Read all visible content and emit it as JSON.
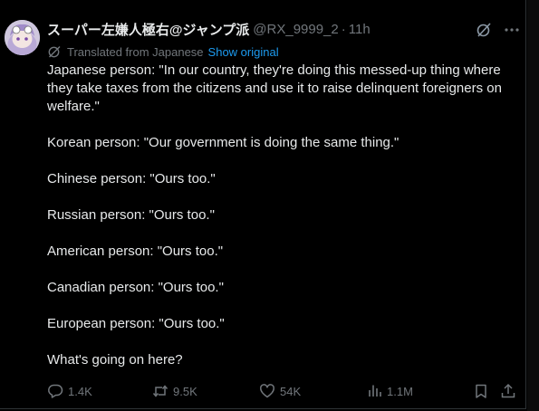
{
  "tweet": {
    "display_name": "スーパー左嫌人極右@ジャンプ派",
    "handle": "@RX_9999_2",
    "separator": "·",
    "time": "11h",
    "translated_label": "Translated from Japanese",
    "show_original_label": "Show original",
    "paragraphs": [
      "Japanese person: \"In our country, they're doing this messed-up thing where they take taxes from the citizens and use it to raise delinquent foreigners on welfare.\"",
      "Korean person: \"Our government is doing the same thing.\"",
      "Chinese person: \"Ours too.\"",
      "Russian person: \"Ours too.\"",
      "American person: \"Ours too.\"",
      "Canadian person: \"Ours too.\"",
      "European person: \"Ours too.\"",
      "What's going on here?"
    ]
  },
  "actions": {
    "replies": "1.4K",
    "reposts": "9.5K",
    "likes": "54K",
    "views": "1.1M"
  },
  "icons": {
    "avatar": "anime-avatar",
    "grok": "grok-icon",
    "more": "more-icon",
    "translate": "translate-icon",
    "reply": "reply-icon",
    "repost": "repost-icon",
    "like": "like-icon",
    "views": "views-icon",
    "bookmark": "bookmark-icon",
    "share": "share-icon"
  },
  "colors": {
    "background": "#000000",
    "text": "#e7e9ea",
    "muted": "#71767b",
    "link": "#1d9bf0"
  }
}
